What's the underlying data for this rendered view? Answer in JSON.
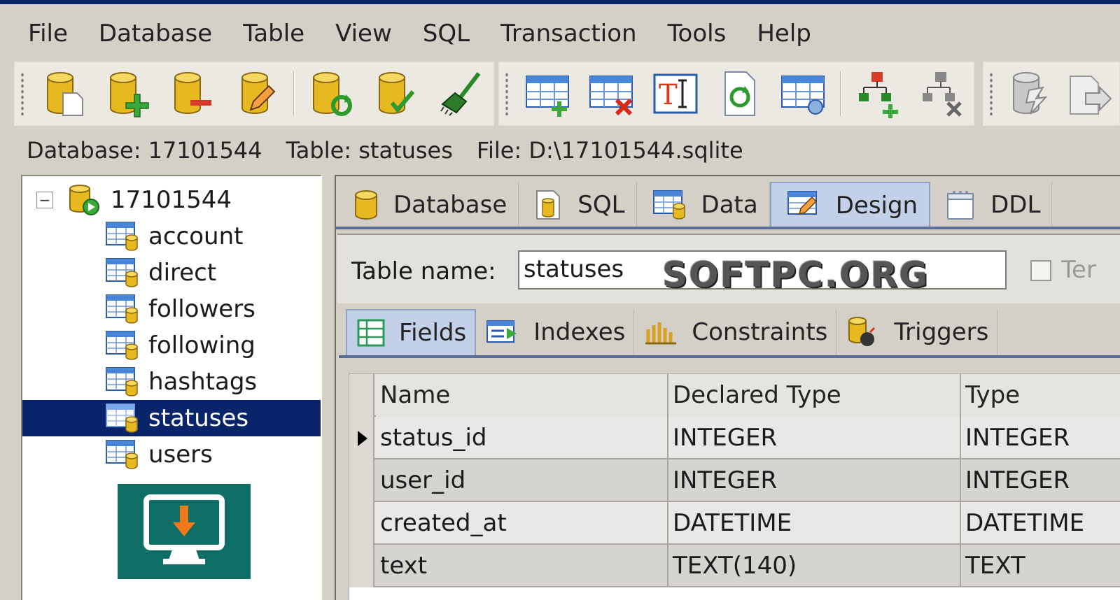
{
  "menu": [
    "File",
    "Database",
    "Table",
    "View",
    "SQL",
    "Transaction",
    "Tools",
    "Help"
  ],
  "toolbar": {
    "group1": [
      "open-database-icon",
      "add-database-icon",
      "remove-database-icon",
      "edit-database-icon",
      "refresh-database-icon",
      "check-database-icon",
      "vacuum-broom-icon"
    ],
    "group2": [
      "create-table-icon",
      "drop-table-icon",
      "rename-table-icon",
      "refresh-table-icon",
      "table-data-icon",
      "add-index-icon",
      "drop-index-icon"
    ],
    "group3": [
      "export-database-icon",
      "import-database-icon"
    ]
  },
  "info": {
    "database": "Database: 17101544",
    "table": "Table: statuses",
    "file": "File: D:\\17101544.sqlite"
  },
  "tree": {
    "root": "17101544",
    "toggle": "−",
    "items": [
      "account",
      "direct",
      "followers",
      "following",
      "hashtags",
      "statuses",
      "users"
    ],
    "selected": "statuses"
  },
  "main_tabs": [
    "Database",
    "SQL",
    "Data",
    "Design",
    "DDL"
  ],
  "active_main_tab": "Design",
  "design": {
    "table_name_label": "Table name:",
    "table_name_value": "statuses",
    "watermark": "SOFTPC.ORG",
    "temp_label": "Ter"
  },
  "sub_tabs": [
    "Fields",
    "Indexes",
    "Constraints",
    "Triggers"
  ],
  "active_sub_tab": "Fields",
  "fields": {
    "columns": [
      "Name",
      "Declared Type",
      "Type"
    ],
    "rows": [
      [
        "status_id",
        "INTEGER",
        "INTEGER"
      ],
      [
        "user_id",
        "INTEGER",
        "INTEGER"
      ],
      [
        "created_at",
        "DATETIME",
        "DATETIME"
      ],
      [
        "text",
        "TEXT(140)",
        "TEXT"
      ]
    ]
  },
  "colors": {
    "selection": "#0a246a",
    "db_gold": "#e8b820",
    "promo_teal": "#0e6e66",
    "promo_arrow": "#f07a1a"
  }
}
